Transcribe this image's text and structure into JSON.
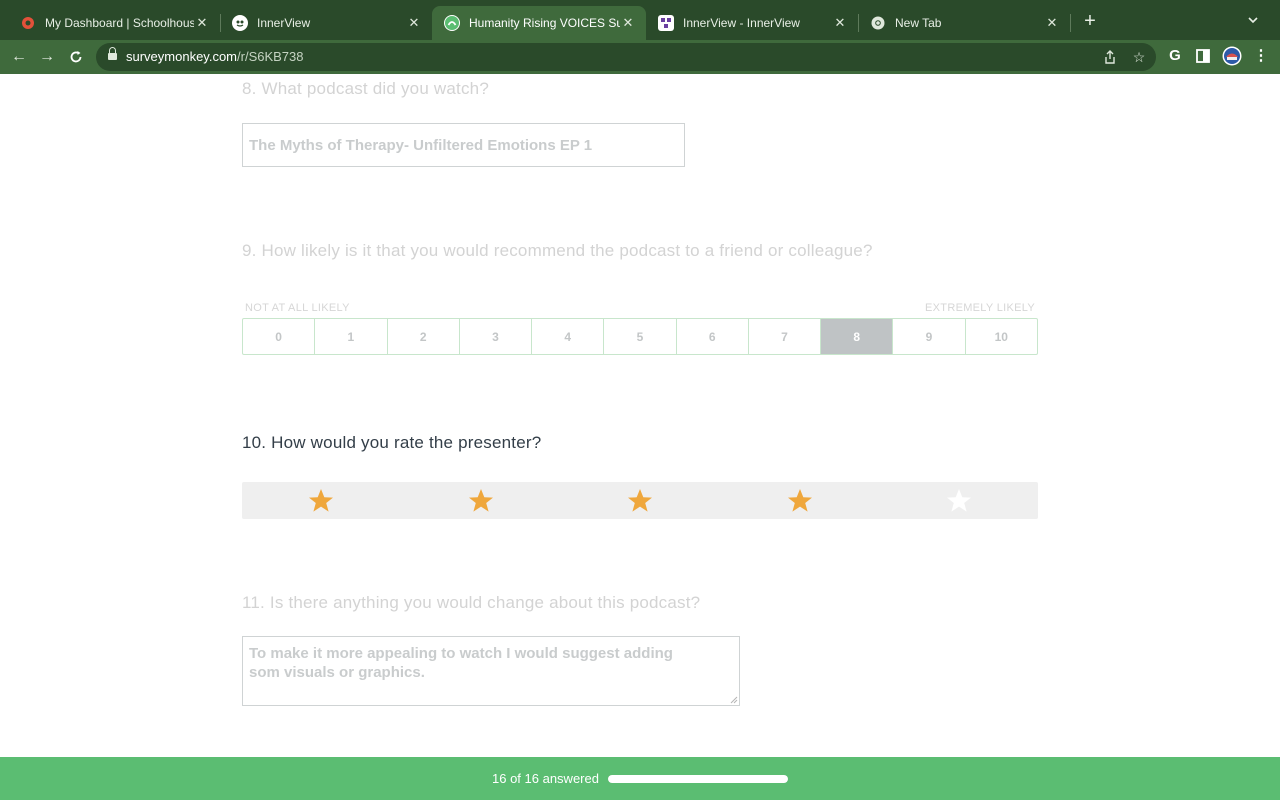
{
  "browser": {
    "tabs": [
      {
        "title": "My Dashboard | Schoolhouse",
        "icon": "schoolhouse-icon",
        "active": false
      },
      {
        "title": "InnerView",
        "icon": "innerview-icon",
        "active": false
      },
      {
        "title": "Humanity Rising VOICES Surv",
        "icon": "surveymonkey-icon",
        "active": true
      },
      {
        "title": "InnerView - InnerView",
        "icon": "innerview-icon",
        "active": false
      },
      {
        "title": "New Tab",
        "icon": "chrome-icon",
        "active": false
      }
    ],
    "url_host": "surveymonkey.com",
    "url_path": "/r/S6KB738",
    "theme_colors": {
      "tabbar": "#2a4a2a",
      "toolbar": "#3f6a3c"
    }
  },
  "survey": {
    "q8": {
      "title": "8. What podcast did you watch?",
      "answer": "The Myths of Therapy- Unfiltered Emotions EP 1"
    },
    "q9": {
      "title": "9. How likely is it that you would recommend the podcast to a friend or colleague?",
      "low_label": "NOT AT ALL LIKELY",
      "high_label": "EXTREMELY LIKELY",
      "options": [
        "0",
        "1",
        "2",
        "3",
        "4",
        "5",
        "6",
        "7",
        "8",
        "9",
        "10"
      ],
      "selected": "8"
    },
    "q10": {
      "title": "10. How would you rate the presenter?",
      "rating": 4,
      "max_rating": 5,
      "star_color": "#efa73c"
    },
    "q11": {
      "title": "11. Is there anything you would change about this podcast?",
      "answer": "To make it more appealing to watch I would suggest adding som visuals or graphics."
    }
  },
  "footer": {
    "progress_text": "16 of 16 answered",
    "progress_fraction": 1.0,
    "color": "#5bbd72"
  }
}
